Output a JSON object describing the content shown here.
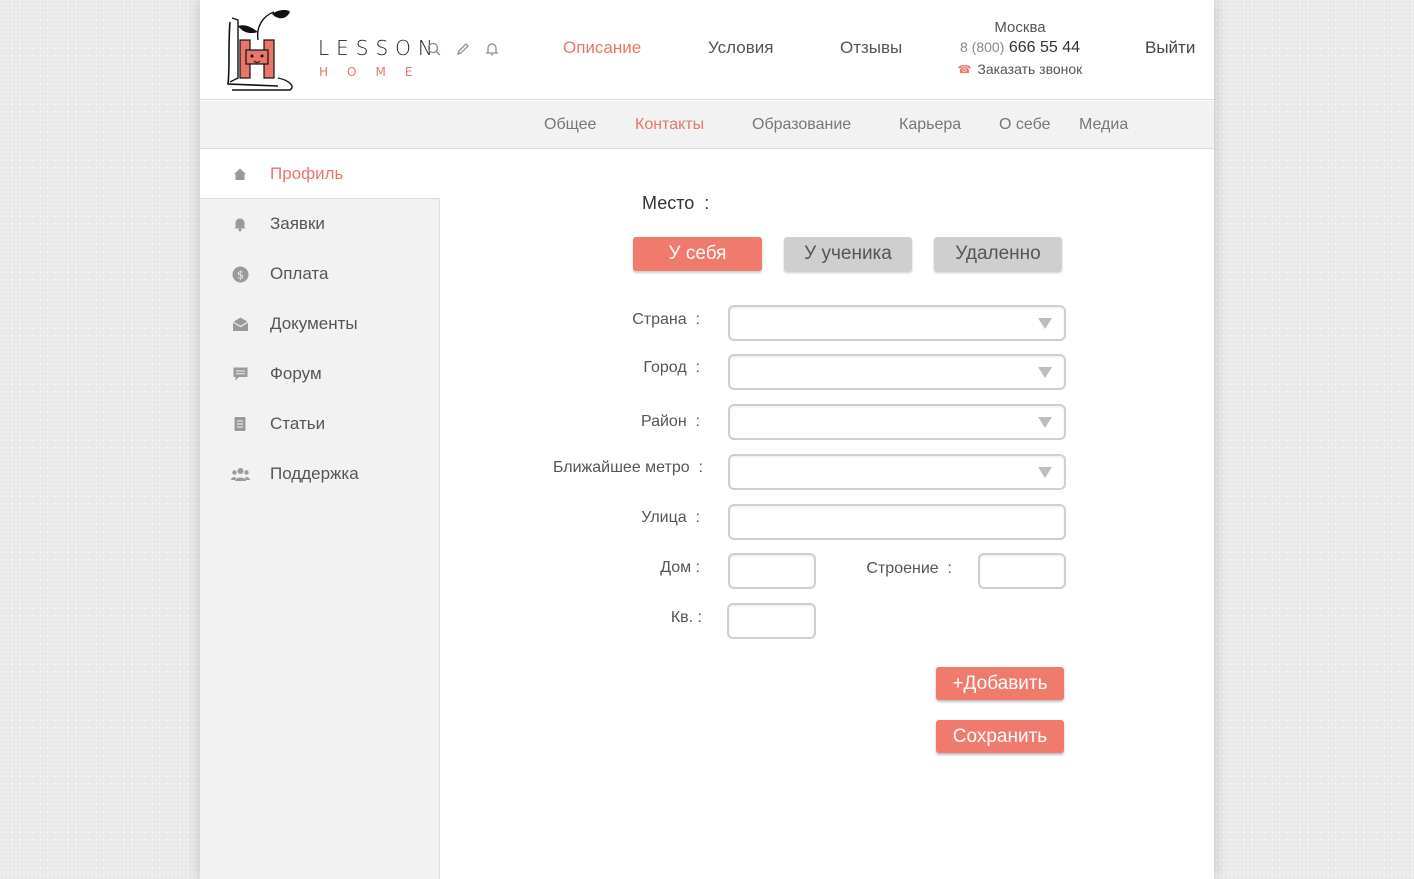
{
  "brand": {
    "line1": "LESSON",
    "line2": "HOME",
    "accent": "#e8766a"
  },
  "header": {
    "icons": [
      "search-icon",
      "pencil-icon",
      "bell-icon"
    ],
    "nav": [
      {
        "label": "Описание",
        "active": true
      },
      {
        "label": "Условия",
        "active": false
      },
      {
        "label": "Отзывы",
        "active": false
      }
    ],
    "contact": {
      "city": "Москва",
      "phone_prefix": "8 (800)",
      "phone": "666 55 44",
      "callback": "Заказать звонок"
    },
    "logout": "Выйти"
  },
  "subnav": {
    "tabs": [
      {
        "label": "Общее",
        "active": false
      },
      {
        "label": "Контакты",
        "active": true
      },
      {
        "label": "Образование",
        "active": false
      },
      {
        "label": "Карьера",
        "active": false
      },
      {
        "label": "О себе",
        "active": false
      },
      {
        "label": "Медиа",
        "active": false
      }
    ]
  },
  "sidebar": {
    "items": [
      {
        "label": "Профиль",
        "icon": "home-icon",
        "active": true
      },
      {
        "label": "Заявки",
        "icon": "bell-icon",
        "active": false
      },
      {
        "label": "Оплата",
        "icon": "dollar-icon",
        "active": false
      },
      {
        "label": "Документы",
        "icon": "envelope-icon",
        "active": false
      },
      {
        "label": "Форум",
        "icon": "chat-icon",
        "active": false
      },
      {
        "label": "Статьи",
        "icon": "document-icon",
        "active": false
      },
      {
        "label": "Поддержка",
        "icon": "people-icon",
        "active": false
      }
    ]
  },
  "form": {
    "place_label": "Место  :",
    "place_options": [
      {
        "label": "У себя",
        "selected": true
      },
      {
        "label": "У ученика",
        "selected": false
      },
      {
        "label": "Удаленно",
        "selected": false
      }
    ],
    "country_label": "Страна  :",
    "city_label": "Город  :",
    "district_label": "Район  :",
    "metro_label": "Ближайшее метро  :",
    "street_label": "Улица  :",
    "house_label": "Дом :",
    "building_label": "Строение  :",
    "apt_label": "Кв. :",
    "country_value": "",
    "city_value": "",
    "district_value": "",
    "metro_value": "",
    "street_value": "",
    "house_value": "",
    "building_value": "",
    "apt_value": "",
    "add_button": "+Добавить",
    "save_button": "Сохранить"
  }
}
